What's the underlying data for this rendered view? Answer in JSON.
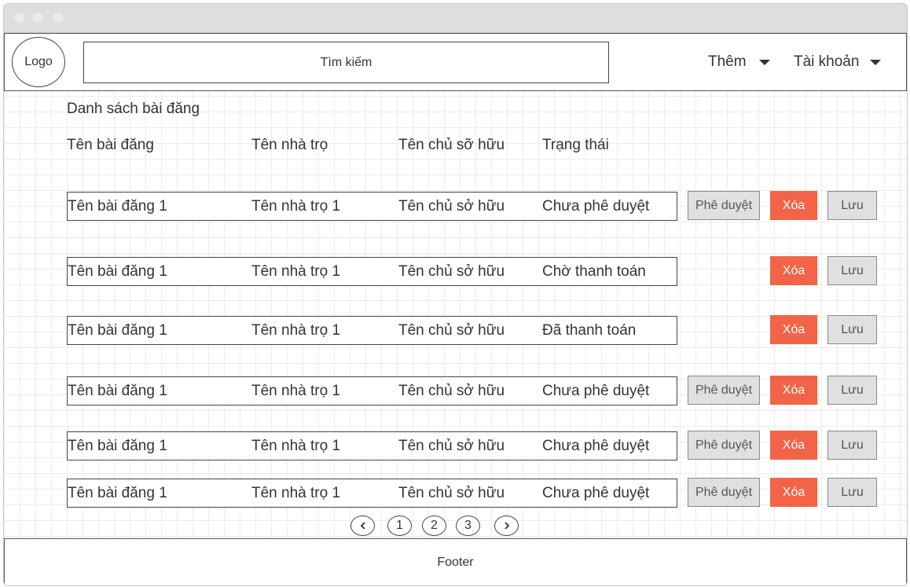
{
  "header": {
    "logo": "Logo",
    "search_placeholder": "Tìm kiếm",
    "menu_more": "Thêm",
    "menu_account": "Tài khoản"
  },
  "main": {
    "title": "Danh sách bài đăng",
    "columns": [
      "Tên bài đăng",
      "Tên nhà trọ",
      "Tên chủ sỡ hữu",
      "Trạng thái"
    ],
    "rows": [
      {
        "post": "Tên bài đăng 1",
        "house": "Tên nhà trọ 1",
        "owner": "Tên chủ sở hữu",
        "status": "Chưa phê duyệt",
        "approve": "Phê duyệt",
        "delete": "Xóa",
        "save": "Lưu"
      },
      {
        "post": "Tên bài đăng 1",
        "house": "Tên nhà trọ 1",
        "owner": "Tên chủ sở hữu",
        "status": "Chờ thanh toán",
        "delete": "Xóa",
        "save": "Lưu"
      },
      {
        "post": "Tên bài đăng 1",
        "house": "Tên nhà trọ 1",
        "owner": "Tên chủ sở hữu",
        "status": "Đã thanh toán",
        "delete": "Xóa",
        "save": "Lưu"
      },
      {
        "post": "Tên bài đăng 1",
        "house": "Tên nhà trọ 1",
        "owner": "Tên chủ sở hữu",
        "status": "Chưa phê duyệt",
        "approve": "Phê duyệt",
        "delete": "Xóa",
        "save": "Lưu"
      },
      {
        "post": "Tên bài đăng 1",
        "house": "Tên nhà trọ 1",
        "owner": "Tên chủ sở hữu",
        "status": "Chưa phê duyệt",
        "approve": "Phê duyệt",
        "delete": "Xóa",
        "save": "Lưu"
      },
      {
        "post": "Tên bài đăng 1",
        "house": "Tên nhà trọ 1",
        "owner": "Tên chủ sở hữu",
        "status": "Chưa phê duyệt",
        "approve": "Phê duyệt",
        "delete": "Xóa",
        "save": "Lưu"
      }
    ]
  },
  "pagination": {
    "prev_icon": "chevron-left-icon",
    "pages": [
      "1",
      "2",
      "3"
    ],
    "next_icon": "chevron-right-icon"
  },
  "footer": {
    "label": "Footer"
  },
  "colors": {
    "delete_button": "#f26447",
    "neutral_button": "#e0e0e0"
  }
}
